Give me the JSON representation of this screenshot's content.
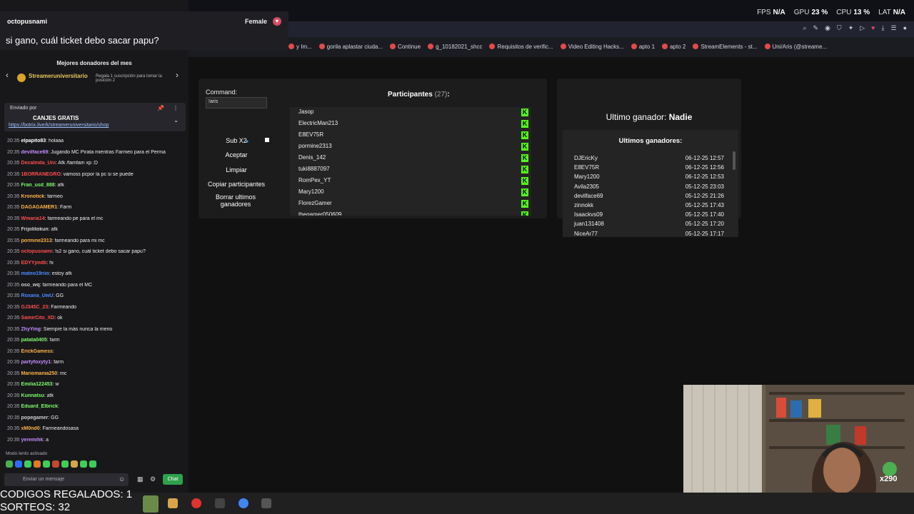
{
  "stats": {
    "fps_label": "FPS",
    "fps": "N/A",
    "gpu_label": "GPU",
    "gpu": "23 %",
    "cpu_label": "CPU",
    "cpu": "13 %",
    "lat_label": "LAT",
    "lat": "N/A"
  },
  "bookmarks": [
    "y Im...",
    "gorila aplastar ciuda...",
    "Continue",
    "g_10182021_shcc",
    "Requisitos de verific...",
    "Video Editing Hacks...",
    "apto 1",
    "apto 2",
    "StreamElements - st...",
    "Uni/Aris (@streame..."
  ],
  "alert": {
    "user": "octopusnami",
    "gender": "Female",
    "message": "si gano, cuál ticket debo sacar papu?"
  },
  "donors": {
    "title": "Mejores donadores del mes",
    "top_name": "Streameruniversitario",
    "top_desc": "Regala 1 suscripción para tomar la posición 2"
  },
  "pinned": {
    "sender": "Enviado por",
    "title": "CANJES GRATIS",
    "link": "https://botrix.live/k/streameruniversitario/shop"
  },
  "chat": [
    {
      "time": "20:35",
      "user": "elpapito83",
      "color": "#ffffff",
      "text": "holaaa"
    },
    {
      "time": "20:35",
      "user": "devilface69",
      "color": "#c58cff",
      "text": "Jugando MC Pirata mientras Farmeo para el Perma"
    },
    {
      "time": "20:35",
      "user": "Decalinda_Uni",
      "color": "#ff4d4d",
      "text": "Afk /famfam xp :D"
    },
    {
      "time": "20:35",
      "user": "1BORRANEGRO",
      "color": "#ff4d4d",
      "text": "vamoss pcpor la pc si se puede"
    },
    {
      "time": "20:35",
      "user": "Fran_usd_888",
      "color": "#7cfc6a",
      "text": "afk"
    },
    {
      "time": "20:35",
      "user": "Kronotick",
      "color": "#ffb347",
      "text": "farmeo"
    },
    {
      "time": "20:35",
      "user": "DAGAGAMER1",
      "color": "#ffb347",
      "text": "Farm"
    },
    {
      "time": "20:35",
      "user": "Wmaria14",
      "color": "#ff4d4d",
      "text": "farmeando pe para el mc"
    },
    {
      "time": "20:35",
      "user": "Frijolitokun",
      "color": "#cfcfcf",
      "text": "afk"
    },
    {
      "time": "20:35",
      "user": "pormine2313",
      "color": "#ffb347",
      "text": "farmeando para mi mc"
    },
    {
      "time": "20:35",
      "user": "octopusnami",
      "color": "#ff4d4d",
      "text": "!s2 si gano, cuál ticket debo sacar papu?"
    },
    {
      "time": "20:35",
      "user": "EDYYjmdb",
      "color": "#ff4d4d",
      "text": "hi"
    },
    {
      "time": "20:35",
      "user": "mateo19riio",
      "color": "#4d8bff",
      "text": "estoy afk"
    },
    {
      "time": "20:35",
      "user": "oso_wq",
      "color": "#cfcfcf",
      "text": "farmeando para el MC"
    },
    {
      "time": "20:35",
      "user": "Roxana_UwU",
      "color": "#4d8bff",
      "text": "GG"
    },
    {
      "time": "20:35",
      "user": "GJ345C_23",
      "color": "#ff4d4d",
      "text": "Farmeando"
    },
    {
      "time": "20:35",
      "user": "SamirCito_XD",
      "color": "#ff4d4d",
      "text": "ok"
    },
    {
      "time": "20:35",
      "user": "ZhyYing",
      "color": "#c58cff",
      "text": "Siempre la más nunca la meno"
    },
    {
      "time": "20:35",
      "user": "patata0405",
      "color": "#7cfc6a",
      "text": "farm"
    },
    {
      "time": "20:35",
      "user": "ErickGamess",
      "color": "#ffb347",
      "text": ""
    },
    {
      "time": "20:35",
      "user": "partyfoxyty1",
      "color": "#c58cff",
      "text": "farm"
    },
    {
      "time": "20:35",
      "user": "Mariomania250",
      "color": "#ffb347",
      "text": "mc"
    },
    {
      "time": "20:35",
      "user": "Emilia122453",
      "color": "#7cfc6a",
      "text": "w"
    },
    {
      "time": "20:35",
      "user": "Kunnatsu",
      "color": "#7cfc6a",
      "text": "afk"
    },
    {
      "time": "20:35",
      "user": "Eduard_Elbrick",
      "color": "#7cfc6a",
      "text": ""
    },
    {
      "time": "20:35",
      "user": "popegamer",
      "color": "#cfcfcf",
      "text": "GG"
    },
    {
      "time": "20:35",
      "user": "xM0nd0",
      "color": "#ffb347",
      "text": "Farmeandosasa"
    },
    {
      "time": "20:35",
      "user": "yeremihk",
      "color": "#c58cff",
      "text": "a"
    }
  ],
  "chat_footer": {
    "slow_mode": "Modo lento activado",
    "placeholder": "Enviar un mensaje",
    "send": "Chat"
  },
  "overlay": {
    "line1": "CODIGOS REGALADOS: 1",
    "line2": "SORTEOS: 32"
  },
  "command": {
    "label": "Command:",
    "value": "!aris"
  },
  "buttons": {
    "sub": "Sub X2",
    "accept": "Aceptar",
    "clear": "Limpiar",
    "copy": "Copiar participantes",
    "clear_winners": "Borrar ultimos ganadores"
  },
  "participants": {
    "title": "Participantes",
    "count": "(27)",
    "colon": ":",
    "names": [
      "Jasop",
      "ElectricMan213",
      "E8EV75R",
      "pormine2313",
      "Denis_142",
      "tuki8887097",
      "RomPex_YT",
      "Mary1200",
      "FlorezGamer",
      "thegamer050609"
    ]
  },
  "last_winner": {
    "label": "Ultimo ganador:",
    "name": "Nadie"
  },
  "winners": {
    "title": "Ultimos ganadores:",
    "rows": [
      {
        "name": "DJEricKy",
        "date": "06-12-25 12:57"
      },
      {
        "name": "E8EV75R",
        "date": "06-12-25 12:56"
      },
      {
        "name": "Mary1200",
        "date": "06-12-25 12:53"
      },
      {
        "name": "Avila2305",
        "date": "05-12-25 23:03"
      },
      {
        "name": "devilface69",
        "date": "05-12-25 21:26"
      },
      {
        "name": "zinnokk",
        "date": "05-12-25 17:43"
      },
      {
        "name": "Isaackvs09",
        "date": "05-12-25 17:40"
      },
      {
        "name": "juan131408",
        "date": "05-12-25 17:20"
      },
      {
        "name": "NiceAr77",
        "date": "05-12-25 17:17"
      }
    ]
  },
  "kick_icon": "kick-k-icon",
  "cam_badge": "x290"
}
